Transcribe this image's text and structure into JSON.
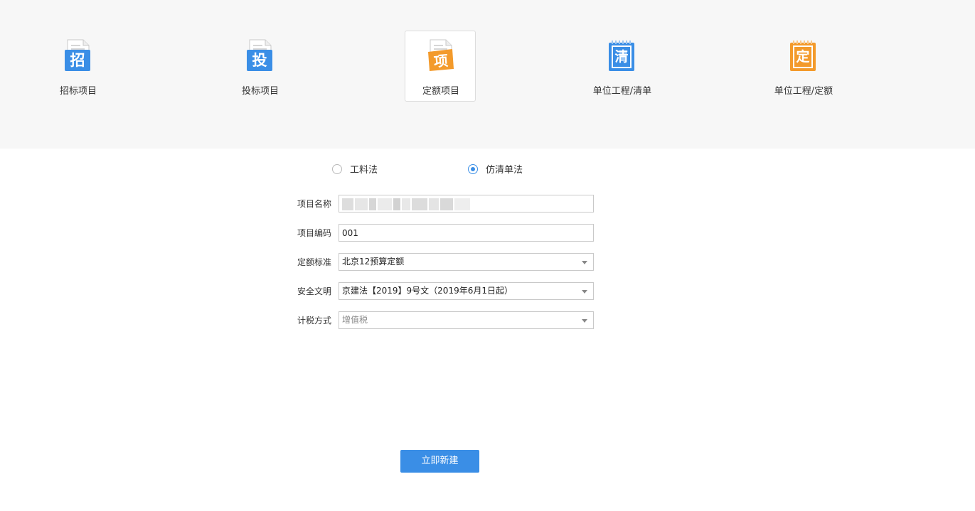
{
  "project_types": [
    {
      "label": "招标项目",
      "glyph": "招",
      "color": "#3a8ee6",
      "icon": "document-icon",
      "selected": false
    },
    {
      "label": "投标项目",
      "glyph": "投",
      "color": "#3a8ee6",
      "icon": "document-icon",
      "selected": false
    },
    {
      "label": "定额项目",
      "glyph": "项",
      "color": "#f39a2b",
      "icon": "document-icon",
      "selected": true
    },
    {
      "label": "单位工程/清单",
      "glyph": "清",
      "color": "#3a8ee6",
      "icon": "notepad-icon",
      "selected": false
    },
    {
      "label": "单位工程/定额",
      "glyph": "定",
      "color": "#f39a2b",
      "icon": "notepad-icon",
      "selected": false
    }
  ],
  "method": {
    "options": [
      {
        "label": "工料法",
        "checked": false
      },
      {
        "label": "仿清单法",
        "checked": true
      }
    ]
  },
  "form": {
    "project_name": {
      "label": "项目名称",
      "value": ""
    },
    "project_code": {
      "label": "项目编码",
      "value": "001"
    },
    "quota_standard": {
      "label": "定额标准",
      "value": "北京12预算定额"
    },
    "safety": {
      "label": "安全文明",
      "value": "京建法【2019】9号文（2019年6月1日起）"
    },
    "tax_method": {
      "label": "计税方式",
      "value": "增值税"
    }
  },
  "actions": {
    "create_label": "立即新建"
  },
  "colors": {
    "accent": "#3a8ee6",
    "orange": "#f39a2b",
    "top_band": "#f7f7f7"
  }
}
